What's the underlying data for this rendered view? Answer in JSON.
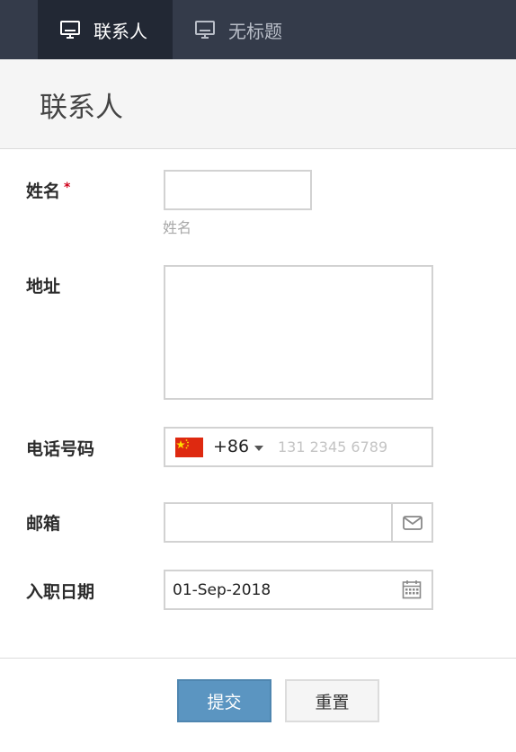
{
  "tabs": [
    {
      "label": "联系人",
      "icon": "monitor-icon",
      "active": true
    },
    {
      "label": "无标题",
      "icon": "monitor-icon",
      "active": false
    }
  ],
  "page": {
    "title": "联系人"
  },
  "form": {
    "name": {
      "label": "姓名",
      "required_mark": "*",
      "value": "",
      "hint": "姓名"
    },
    "address": {
      "label": "地址",
      "value": ""
    },
    "phone": {
      "label": "电话号码",
      "country_code": "+86",
      "flag": "china-flag-icon",
      "placeholder": "131 2345 6789"
    },
    "email": {
      "label": "邮箱",
      "value": "",
      "icon": "envelope-icon"
    },
    "join_date": {
      "label": "入职日期",
      "value": "01-Sep-2018",
      "icon": "calendar-icon"
    }
  },
  "actions": {
    "submit_label": "提交",
    "reset_label": "重置"
  },
  "colors": {
    "topbar": "#343b4a",
    "active_tab": "#222834",
    "submit": "#5b95c1",
    "required": "#d0021b"
  }
}
